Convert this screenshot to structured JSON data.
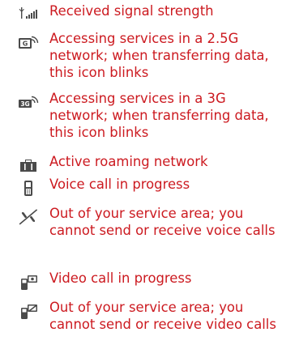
{
  "colors": {
    "text": "#cc1a20",
    "icon": "#4a4a4a"
  },
  "items": [
    {
      "icon": "signal-strength-icon",
      "text": "Received signal strength"
    },
    {
      "icon": "gprs-network-icon",
      "text": "Accessing services in a 2.5G network; when transferring data, this icon blinks"
    },
    {
      "icon": "3g-network-icon",
      "text": "Accessing services in a 3G network; when transferring data, this icon blinks"
    },
    {
      "icon": "roaming-icon",
      "text": "Active roaming network"
    },
    {
      "icon": "voice-call-icon",
      "text": "Voice call in progress"
    },
    {
      "icon": "no-voice-service-icon",
      "text": "Out of your service area; you cannot send or receive voice calls"
    },
    {
      "icon": "video-call-icon",
      "text": "Video call in progress"
    },
    {
      "icon": "no-video-service-icon",
      "text": "Out of your service area; you cannot send or receive video calls"
    }
  ]
}
